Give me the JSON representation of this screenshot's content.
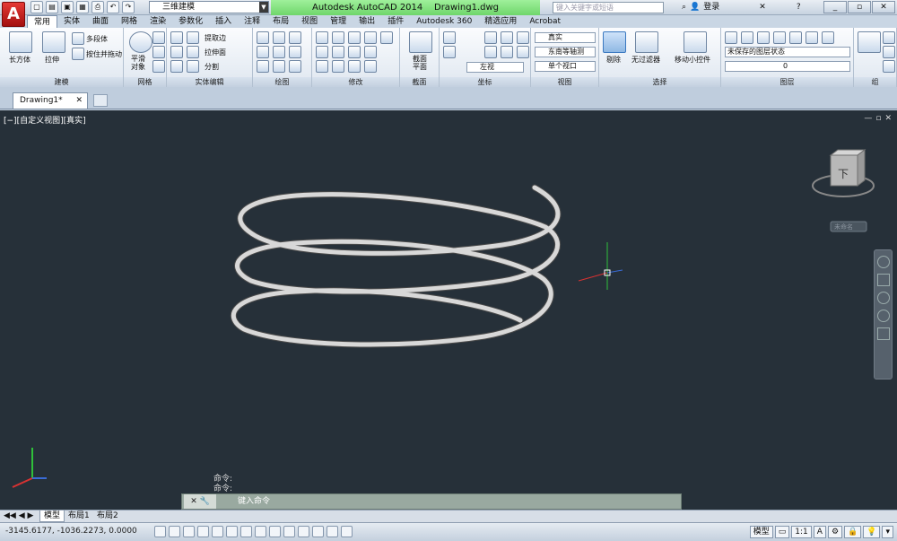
{
  "app": {
    "logo": "A",
    "title_app": "Autodesk AutoCAD 2014",
    "title_doc": "Drawing1.dwg",
    "workspace": "三维建模",
    "search_placeholder": "键入关键字或短语",
    "user": "登录"
  },
  "tabs": [
    "常用",
    "实体",
    "曲面",
    "网格",
    "渲染",
    "参数化",
    "插入",
    "注释",
    "布局",
    "视图",
    "管理",
    "输出",
    "插件",
    "Autodesk 360",
    "精选应用",
    "Acrobat"
  ],
  "ribbon": {
    "modeling": {
      "box": "长方体",
      "extrude": "拉伸",
      "polysolid": "多段体",
      "presspull": "按住并拖动",
      "label": "建模"
    },
    "mesh": {
      "smooth": "平滑\n对象",
      "label": "网格"
    },
    "solid_edit": {
      "extract": "提取边",
      "extrude_face": "拉伸面",
      "separate": "分割",
      "label": "实体编辑"
    },
    "draw": {
      "label": "绘图"
    },
    "modify": {
      "label": "修改"
    },
    "section": {
      "plane": "截面\n平面",
      "label": "截面"
    },
    "coords": {
      "view": "左视",
      "label": "坐标"
    },
    "view": {
      "style": "真实",
      "direction": "东南等轴测",
      "viewport": "单个视口",
      "label": "视图"
    },
    "selection": {
      "cull": "剔除",
      "filter": "无过滤器",
      "gizmo": "移动小控件",
      "label": "选择"
    },
    "layers": {
      "state": "未保存的图层状态",
      "current": "0",
      "label": "图层"
    },
    "group": {
      "label": "组"
    }
  },
  "document": {
    "tab": "Drawing1*"
  },
  "viewport": {
    "label": "[−][自定义视图][真实]",
    "cube_face": "下",
    "wcs": "未命名"
  },
  "command": {
    "history": [
      "命令:",
      "命令:"
    ],
    "prompt": "键入命令"
  },
  "layout_tabs": [
    "模型",
    "布局1",
    "布局2"
  ],
  "status": {
    "coords": "-3145.6177, -1036.2273, 0.0000",
    "model": "模型",
    "scale": "1:1"
  }
}
